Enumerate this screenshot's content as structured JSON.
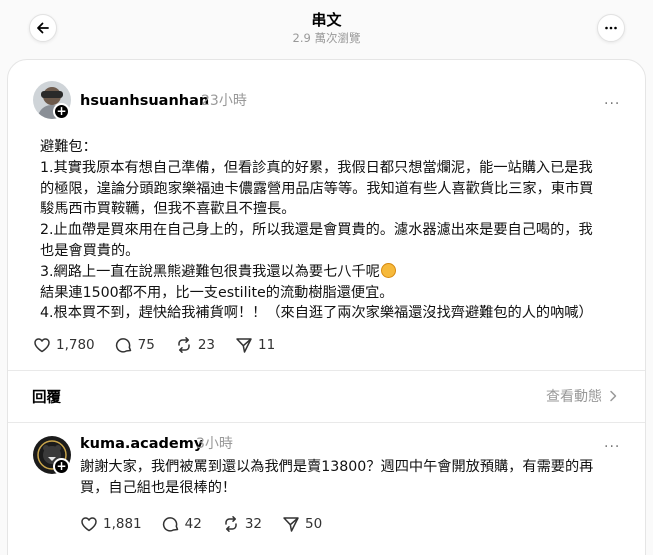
{
  "header": {
    "title": "串文",
    "views": "2.9 萬次瀏覽"
  },
  "post": {
    "username": "hsuanhsuanhan",
    "time": "23小時",
    "lines": [
      "避難包：",
      "1.其實我原本有想自己準備，但看診真的好累，我假日都只想當爛泥，能一站購入已是我",
      "的極限，遑論分頭跑家樂福迪卡儂露營用品店等等。我知道有些人喜歡貨比三家，東市買",
      "駿馬西市買鞍韉，但我不喜歡且不擅長。",
      "2.止血帶是買來用在自己身上的，所以我還是會買貴的。濾水器濾出來是要自己喝的，我",
      "也是會買貴的。",
      "3.網路上一直在說黑熊避難包很貴我還以為要七八千呢",
      "結果連1500都不用，比一支estilite的流動樹脂還便宜。",
      "4.根本買不到，趕快給我補貨啊！！（來自逛了兩次家樂福還沒找齊避難包的人的吶喊）"
    ],
    "likes": "1,780",
    "comments": "75",
    "reposts": "23",
    "shares": "11"
  },
  "replies_section": {
    "label": "回覆",
    "view_activity": "查看動態"
  },
  "reply": {
    "username": "kuma.academy",
    "time": "3小時",
    "lines": [
      "謝謝大家，我們被罵到還以為我們是賣13800？週四中午會開放預購，有需要的再",
      "買，自己組也是很棒的！"
    ],
    "likes": "1,881",
    "comments": "42",
    "reposts": "32",
    "shares": "50"
  }
}
